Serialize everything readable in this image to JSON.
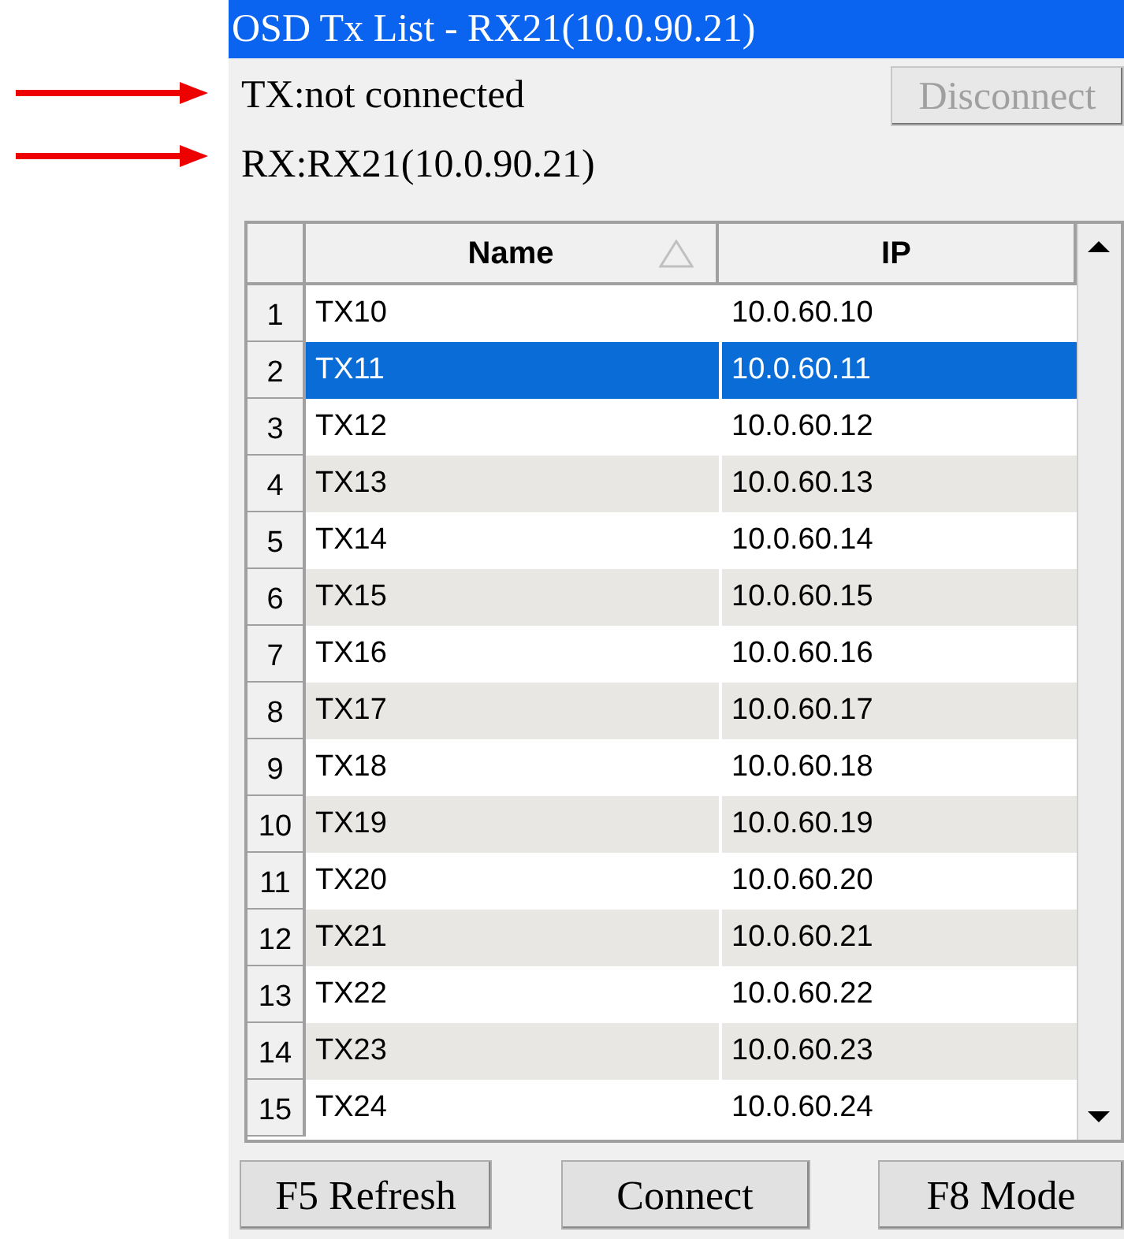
{
  "window": {
    "title": "OSD Tx List - RX21(10.0.90.21)"
  },
  "status": {
    "tx": "TX:not connected",
    "rx": "RX:RX21(10.0.90.21)"
  },
  "disconnect_button": {
    "label": "Disconnect",
    "disabled": true
  },
  "table": {
    "columns": [
      {
        "label": "Name",
        "sorted": true
      },
      {
        "label": "IP",
        "sorted": false
      }
    ],
    "rows": [
      {
        "index": "1",
        "name": "TX10",
        "ip": "10.0.60.10",
        "selected": false
      },
      {
        "index": "2",
        "name": "TX11",
        "ip": "10.0.60.11",
        "selected": true
      },
      {
        "index": "3",
        "name": "TX12",
        "ip": "10.0.60.12",
        "selected": false
      },
      {
        "index": "4",
        "name": "TX13",
        "ip": "10.0.60.13",
        "selected": false
      },
      {
        "index": "5",
        "name": "TX14",
        "ip": "10.0.60.14",
        "selected": false
      },
      {
        "index": "6",
        "name": "TX15",
        "ip": "10.0.60.15",
        "selected": false
      },
      {
        "index": "7",
        "name": "TX16",
        "ip": "10.0.60.16",
        "selected": false
      },
      {
        "index": "8",
        "name": "TX17",
        "ip": "10.0.60.17",
        "selected": false
      },
      {
        "index": "9",
        "name": "TX18",
        "ip": "10.0.60.18",
        "selected": false
      },
      {
        "index": "10",
        "name": "TX19",
        "ip": "10.0.60.19",
        "selected": false
      },
      {
        "index": "11",
        "name": "TX20",
        "ip": "10.0.60.20",
        "selected": false
      },
      {
        "index": "12",
        "name": "TX21",
        "ip": "10.0.60.21",
        "selected": false
      },
      {
        "index": "13",
        "name": "TX22",
        "ip": "10.0.60.22",
        "selected": false
      },
      {
        "index": "14",
        "name": "TX23",
        "ip": "10.0.60.23",
        "selected": false
      },
      {
        "index": "15",
        "name": "TX24",
        "ip": "10.0.60.24",
        "selected": false
      }
    ]
  },
  "buttons": [
    "F5 Refresh",
    "Connect",
    "F8 Mode"
  ]
}
